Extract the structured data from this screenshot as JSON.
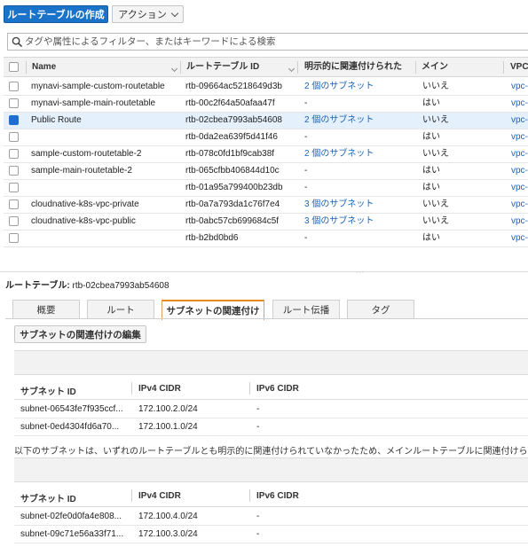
{
  "toolbar": {
    "create_label": "ルートテーブルの作成",
    "action_label": "アクション"
  },
  "search": {
    "placeholder": "タグや属性によるフィルター、またはキーワードによる検索"
  },
  "table": {
    "columns": [
      "Name",
      "ルートテーブル ID",
      "明示的に関連付けられた",
      "メイン",
      "VPC"
    ],
    "rows": [
      {
        "name": "mynavi-sample-custom-routetable",
        "id": "rtb-09664ac5218649d3b",
        "explicit": "2 個のサブネット",
        "main": "いいえ",
        "vpc": "vpc-",
        "selected": false
      },
      {
        "name": "mynavi-sample-main-routetable",
        "id": "rtb-00c2f64a50afaa47f",
        "explicit": "-",
        "main": "はい",
        "vpc": "vpc-",
        "selected": false
      },
      {
        "name": "Public Route",
        "id": "rtb-02cbea7993ab54608",
        "explicit": "2 個のサブネット",
        "main": "いいえ",
        "vpc": "vpc-",
        "selected": true
      },
      {
        "name": "",
        "id": "rtb-0da2ea639f5d41f46",
        "explicit": "-",
        "main": "はい",
        "vpc": "vpc-",
        "selected": false
      },
      {
        "name": "sample-custom-routetable-2",
        "id": "rtb-078c0fd1bf9cab38f",
        "explicit": "2 個のサブネット",
        "main": "いいえ",
        "vpc": "vpc-",
        "selected": false
      },
      {
        "name": "sample-main-routetable-2",
        "id": "rtb-065cfbb406844d10c",
        "explicit": "-",
        "main": "はい",
        "vpc": "vpc-",
        "selected": false
      },
      {
        "name": "",
        "id": "rtb-01a95a799400b23db",
        "explicit": "-",
        "main": "はい",
        "vpc": "vpc-",
        "selected": false
      },
      {
        "name": "cloudnative-k8s-vpc-private",
        "id": "rtb-0a7a793da1c76f7e4",
        "explicit": "3 個のサブネット",
        "main": "いいえ",
        "vpc": "vpc-",
        "selected": false
      },
      {
        "name": "cloudnative-k8s-vpc-public",
        "id": "rtb-0abc57cb699684c5f",
        "explicit": "3 個のサブネット",
        "main": "いいえ",
        "vpc": "vpc-",
        "selected": false
      },
      {
        "name": "",
        "id": "rtb-b2bd0bd6",
        "explicit": "-",
        "main": "はい",
        "vpc": "vpc-",
        "selected": false
      }
    ]
  },
  "detail": {
    "label": "ルートテーブル:",
    "id": "rtb-02cbea7993ab54608",
    "tabs": [
      "概要",
      "ルート",
      "サブネットの関連付け",
      "ルート伝播",
      "タグ"
    ],
    "active_tab": 2,
    "edit_label": "サブネットの関連付けの編集",
    "columns": [
      "サブネット ID",
      "IPv4 CIDR",
      "IPv6 CIDR"
    ],
    "explicit_rows": [
      {
        "subnet": "subnet-06543fe7f935ccf...",
        "ipv4": "172.100.2.0/24",
        "ipv6": "-"
      },
      {
        "subnet": "subnet-0ed4304fd6a70...",
        "ipv4": "172.100.1.0/24",
        "ipv6": "-"
      }
    ],
    "note": "以下のサブネットは、いずれのルートテーブルとも明示的に関連付けられていなかったため、メインルートテーブルに関連付けられ",
    "implicit_rows": [
      {
        "subnet": "subnet-02fe0d0fa4e808...",
        "ipv4": "172.100.4.0/24",
        "ipv6": "-"
      },
      {
        "subnet": "subnet-09c71e56a33f71...",
        "ipv4": "172.100.3.0/24",
        "ipv6": "-"
      }
    ]
  },
  "colors": {
    "primary": "#1a73c9",
    "link": "#1e63b6",
    "selected_row": "#e4f0fb",
    "active_tab": "#e88b1c"
  }
}
